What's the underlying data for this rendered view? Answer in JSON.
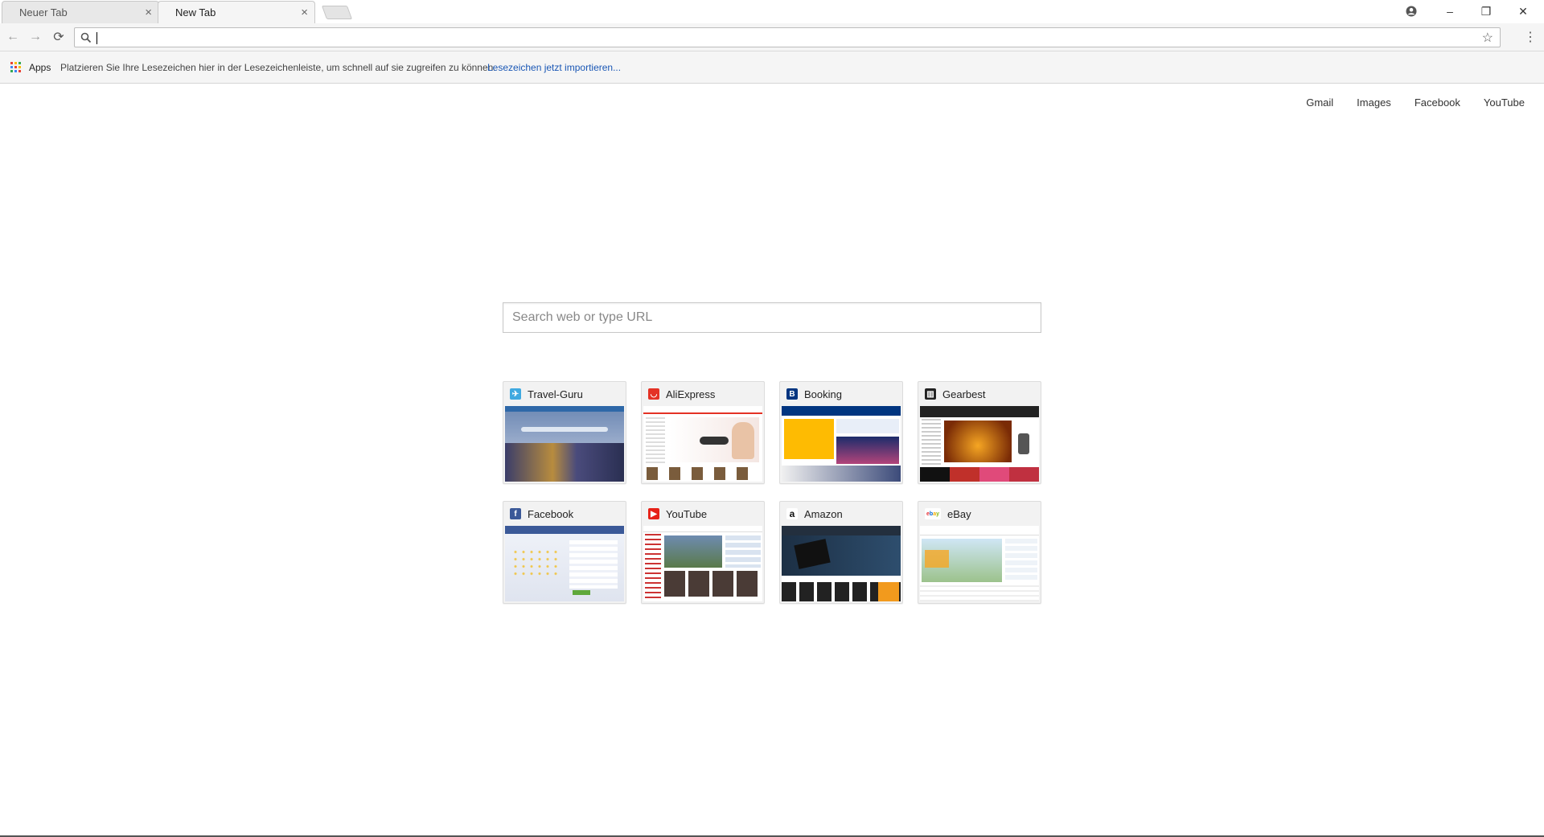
{
  "tabs": [
    {
      "title": "Neuer Tab",
      "active": false
    },
    {
      "title": "New Tab",
      "active": true
    }
  ],
  "icons": {
    "tab_close": "×",
    "back": "←",
    "forward": "→",
    "reload": "⟳",
    "star": "☆",
    "menu": "⋮",
    "minimize": "–",
    "restore": "❐",
    "close": "✕",
    "profile": "●"
  },
  "omnibox": {
    "value": "",
    "placeholder": ""
  },
  "bookmarks_bar": {
    "apps_label": "Apps",
    "hint": "Platzieren Sie Ihre Lesezeichen hier in der Lesezeichenleiste, um schnell auf sie zugreifen zu können.",
    "import_link": "Lesezeichen jetzt importieren..."
  },
  "top_links": [
    "Gmail",
    "Images",
    "Facebook",
    "YouTube"
  ],
  "search": {
    "placeholder": "Search web or type URL"
  },
  "tiles": [
    {
      "title": "Travel-Guru",
      "favicon_color": "#3fa9e0"
    },
    {
      "title": "AliExpress",
      "favicon_color": "#e43225"
    },
    {
      "title": "Booking",
      "favicon_color": "#003580"
    },
    {
      "title": "Gearbest",
      "favicon_color": "#222222"
    },
    {
      "title": "Facebook",
      "favicon_color": "#3b5998"
    },
    {
      "title": "YouTube",
      "favicon_color": "#e62117"
    },
    {
      "title": "Amazon",
      "favicon_color": "#111111"
    },
    {
      "title": "eBay",
      "favicon_color": "#ffffff"
    }
  ],
  "colors": {
    "link_blue": "#1a57b5",
    "apps_grid": [
      "#ea4335",
      "#fbbc05",
      "#34a853",
      "#4285f4",
      "#ea4335",
      "#fbbc05",
      "#34a853",
      "#4285f4",
      "#ea4335"
    ]
  }
}
